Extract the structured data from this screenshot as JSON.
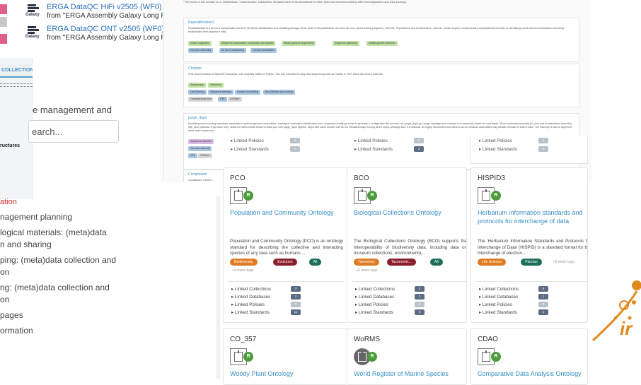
{
  "galaxy": {
    "logo_text": "Galaxy",
    "items": [
      {
        "title": "ERGA DataQC HiFi v2505 (WF0)",
        "subtitle": "from \"ERGA Assembly Galaxy Long Reads &"
      },
      {
        "title": "ERGA DataQC ONT v2505 (WF0)",
        "subtitle": "from \"ERGA Assembly Galaxy Long Reads &"
      }
    ]
  },
  "left": {
    "collections_tab": "COLLECTIONS",
    "structures_label": "ructures",
    "management_text": "e management and",
    "search_placeholder": "earch...",
    "red_stub": "ation",
    "nav_items": [
      "nagement planning",
      "logical materials: (meta)data",
      "n and sharing",
      "ping: (meta)data collection and",
      "on",
      "ng: (meta)data collection and",
      "on",
      "pages",
      "ormation"
    ]
  },
  "mid": {
    "top_note": "*The focus of this domain is on multicellular, \"macroscopic\" eukaryotes, because there is an abundance of other tools and services working with microorganisms and their ecology.",
    "tools": [
      {
        "name": "RepeatModeler2",
        "desc": "RepeatModeler is a de novo transposable element (TE) family identification and modeling package. At the heart of RepeatModeler are three de-novo repeat finding programs ( RECON, RepeatScout and LtrHarvest/Ltr_retriever ) which employ complementary computational methods for identifying repeat element boundaries and family relationships from sequence data.",
        "tags_row1": [
          "Model organisms",
          "Sequence composition, complexity and repeats",
          "Whole genome sequencing",
          "Sequence assembly",
          "Mobile genetic elements"
        ],
        "tags_row2": [
          "Genome assembly",
          "de Novo sequencing",
          "Genome annotation"
        ]
      },
      {
        "name": "Chopper",
        "desc": "Rust implementation of NanoFilt+NanoLyse, both originally written in Python. This tool, intended for long read sequencing such as PacBio or ONT, filters and trims a fastq file.",
        "tags_row1": [
          "Sequencing",
          "Genomics"
        ],
        "tags_row2": [
          "Data filtering",
          "Sequence trimming",
          "Scatter plot plotting",
          "Box-Whisker plot plotting"
        ],
        "tags_row3": [
          "Command-line tool",
          "GPL",
          "CNTaxer"
        ]
      },
      {
        "name": "purge_dups",
        "desc": "Identifying and removing haplotypic duplication in primary genome assemblies / haplotypic duplication identification tool / scripts/pd_config.py: script to generate a configuration file used by run_purge_dups.py / purge haplotigs and overlaps in an assembly based on read depth / Given a primary assembly pri_asm and an alternative assembly hap_asm (optional, if you have one), follow the steps shown below to build your own purge_dups pipeline, steps with same number can be run simultaneously. Among all the steps, although step 4 is optional, we highly recommend our users to do so, because assemblies may contain overlaps in such a case. The final step 4 can be applied in these three sequences.",
        "tags": [
          "Sequence assembl",
          "Genome assembl",
          "GPL",
          "CNTaxer"
        ]
      },
      {
        "name": "Compleasm",
        "desc": "Compleasm: a faster..."
      }
    ],
    "top_links": [
      {
        "label": "Linked Policies",
        "count": "0"
      },
      {
        "label": "Linked Standards",
        "count": "0"
      }
    ],
    "top_links_2": [
      {
        "label": "Linked Policies",
        "count": "0"
      },
      {
        "label": "Linked Standards",
        "count": "3"
      }
    ],
    "top_links_3": [
      {
        "label": "Linked Policies",
        "count": "0"
      },
      {
        "label": "Linked Standards",
        "count": "0"
      }
    ]
  },
  "cards": [
    {
      "abbr": "PCO",
      "badge": "R",
      "title": "Population and Community Ontology",
      "desc": "Population and Community Ontology (PCO) is an ontology standard for describing the collective and interacting species of any taxa such as humans ...",
      "tags": [
        {
          "label": "Biodiversity",
          "color": "#e07b22"
        },
        {
          "label": "Evolution",
          "color": "#8a1e2c"
        },
        {
          "label": "All",
          "color": "#1a6e5a"
        }
      ],
      "more": "+4 more tags",
      "links": [
        {
          "label": "Linked Collections",
          "count": "3"
        },
        {
          "label": "Linked Databases",
          "count": "2"
        },
        {
          "label": "Linked Policies",
          "count": "0"
        },
        {
          "label": "Linked Standards",
          "count": "11"
        }
      ]
    },
    {
      "abbr": "BCO",
      "badge": "R",
      "title": "Biological Collections Ontology",
      "desc": "The Biological Collections Ontology (BCO) supports the interoperability of biodiversity data, including data on museum collections, environmenta...",
      "tags": [
        {
          "label": "Taxonomy",
          "color": "#e07b22"
        },
        {
          "label": "Taxonomic...",
          "color": "#8a1e2c"
        },
        {
          "label": "All",
          "color": "#1a6e5a"
        }
      ],
      "more": "+6 more tags",
      "links": [
        {
          "label": "Linked Collections",
          "count": "2"
        },
        {
          "label": "Linked Databases",
          "count": "1"
        },
        {
          "label": "Linked Policies",
          "count": "0"
        },
        {
          "label": "Linked Standards",
          "count": "5"
        }
      ]
    },
    {
      "abbr": "HISPID3",
      "badge": "R",
      "title": "Herbarium information standards and protocols for interchange of data",
      "desc": "The 'Herbarium Information Standards and Protocols for Interchange of Data' (HISPID) is a standard format for the interchange of electron...",
      "tags": [
        {
          "label": "Life Science",
          "color": "#e07b22"
        },
        {
          "label": "Plantae",
          "color": "#1a6e5a"
        }
      ],
      "more": "+3 more tags",
      "links": [
        {
          "label": "Linked Collections",
          "count": "8"
        },
        {
          "label": "Linked Databases",
          "count": "1"
        },
        {
          "label": "Linked Policies",
          "count": "0"
        },
        {
          "label": "Linked Standards",
          "count": "1"
        }
      ]
    },
    {
      "abbr": "CO_357",
      "badge": "R",
      "title": "Woody Plant Ontology"
    },
    {
      "abbr": "WoRMS",
      "badge": "R",
      "title": "World Register of Marine Species"
    },
    {
      "abbr": "CDAO",
      "badge": "R",
      "title": "Comparative Data Analysis Ontology"
    }
  ],
  "deco": {
    "text": "ir"
  }
}
